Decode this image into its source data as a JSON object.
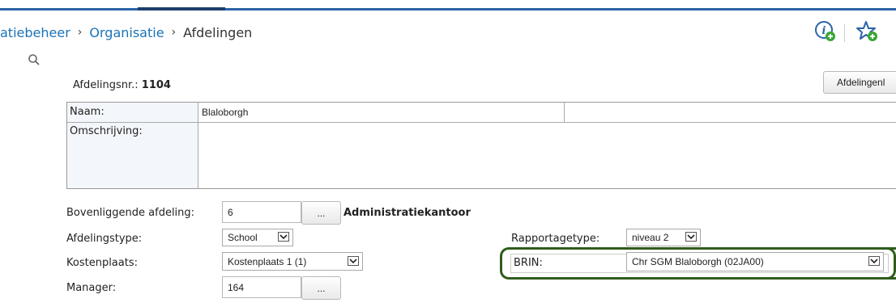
{
  "breadcrumb": {
    "items": [
      "atiebeheer",
      "Organisatie",
      "Afdelingen"
    ],
    "separator": "›"
  },
  "toolbar": {
    "info_icon": "info-plus-icon",
    "favorite_icon": "star-plus-icon"
  },
  "header": {
    "afdelingsnr_label": "Afdelingsnr.:",
    "afdelingsnr_value": "1104",
    "afdelingen_button": "Afdelingenl"
  },
  "form": {
    "naam_label": "Naam:",
    "naam_value": "Blaloborgh",
    "omschrijving_label": "Omschrijving:",
    "omschrijving_value": "",
    "bovenliggende_label": "Bovenliggende afdeling:",
    "bovenliggende_value": "6",
    "bovenliggende_name": "Administratiekantoor",
    "lookup_button": "...",
    "afdelingstype_label": "Afdelingstype:",
    "afdelingstype_value": "School",
    "kostenplaats_label": "Kostenplaats:",
    "kostenplaats_value": "Kostenplaats 1 (1)",
    "manager_label": "Manager:",
    "manager_value": "164",
    "rapportagetype_label": "Rapportagetype:",
    "rapportagetype_value": "niveau 2",
    "brin_label": "BRIN:",
    "brin_value": "Chr SGM Blaloborgh (02JA00)"
  },
  "colors": {
    "accent_blue": "#2a64a8",
    "link": "#1a73b7",
    "highlight_green": "#2f5c1c",
    "icon_green": "#3aa635"
  }
}
